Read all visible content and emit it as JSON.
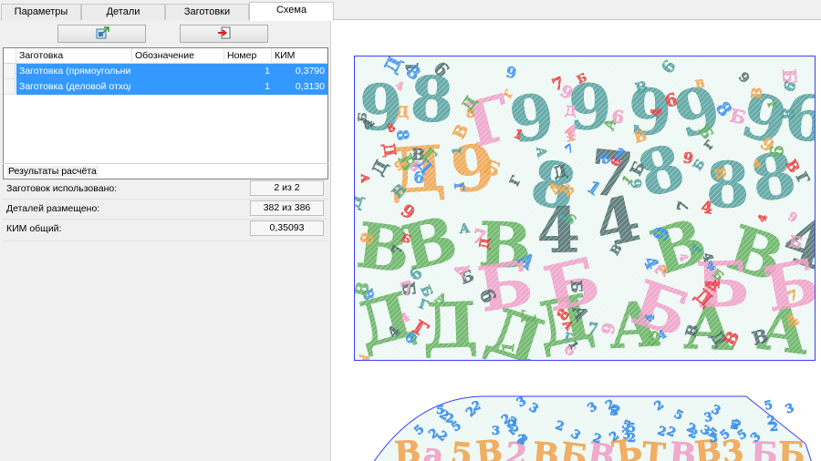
{
  "tabs": [
    {
      "label": "Параметры"
    },
    {
      "label": "Детали"
    },
    {
      "label": "Заготовки"
    },
    {
      "label": "Схема"
    }
  ],
  "toolbar": {
    "export_icon": "export-sheet-icon",
    "import_icon": "import-sheet-icon"
  },
  "grid": {
    "columns": [
      "Заготовка",
      "Обозначение",
      "Номер",
      "КИМ"
    ],
    "rows": [
      {
        "name": "Заготовка (прямоугольник)",
        "designation": "",
        "number": "1",
        "kim": "0,3790"
      },
      {
        "name": "Заготовка (деловой отход)",
        "designation": "",
        "number": "1",
        "kim": "0,3130"
      }
    ]
  },
  "results": {
    "title": "Результаты расчёта",
    "blanks_label": "Заготовок использовано:",
    "blanks_value": "2 из 2",
    "parts_label": "Деталей размещено:",
    "parts_value": "382 из 386",
    "kim_label": "КИМ общий:",
    "kim_value": "0,35093"
  },
  "colors": {
    "selection": "#3399ff",
    "sheet_border": "#3c3cff",
    "teal": "#4f9e9b",
    "orange": "#f0a24a",
    "pink": "#f09cc6",
    "red": "#e83a3a",
    "green": "#5faf5a",
    "blue": "#3a8ee8",
    "dark": "#4a6a6a"
  }
}
